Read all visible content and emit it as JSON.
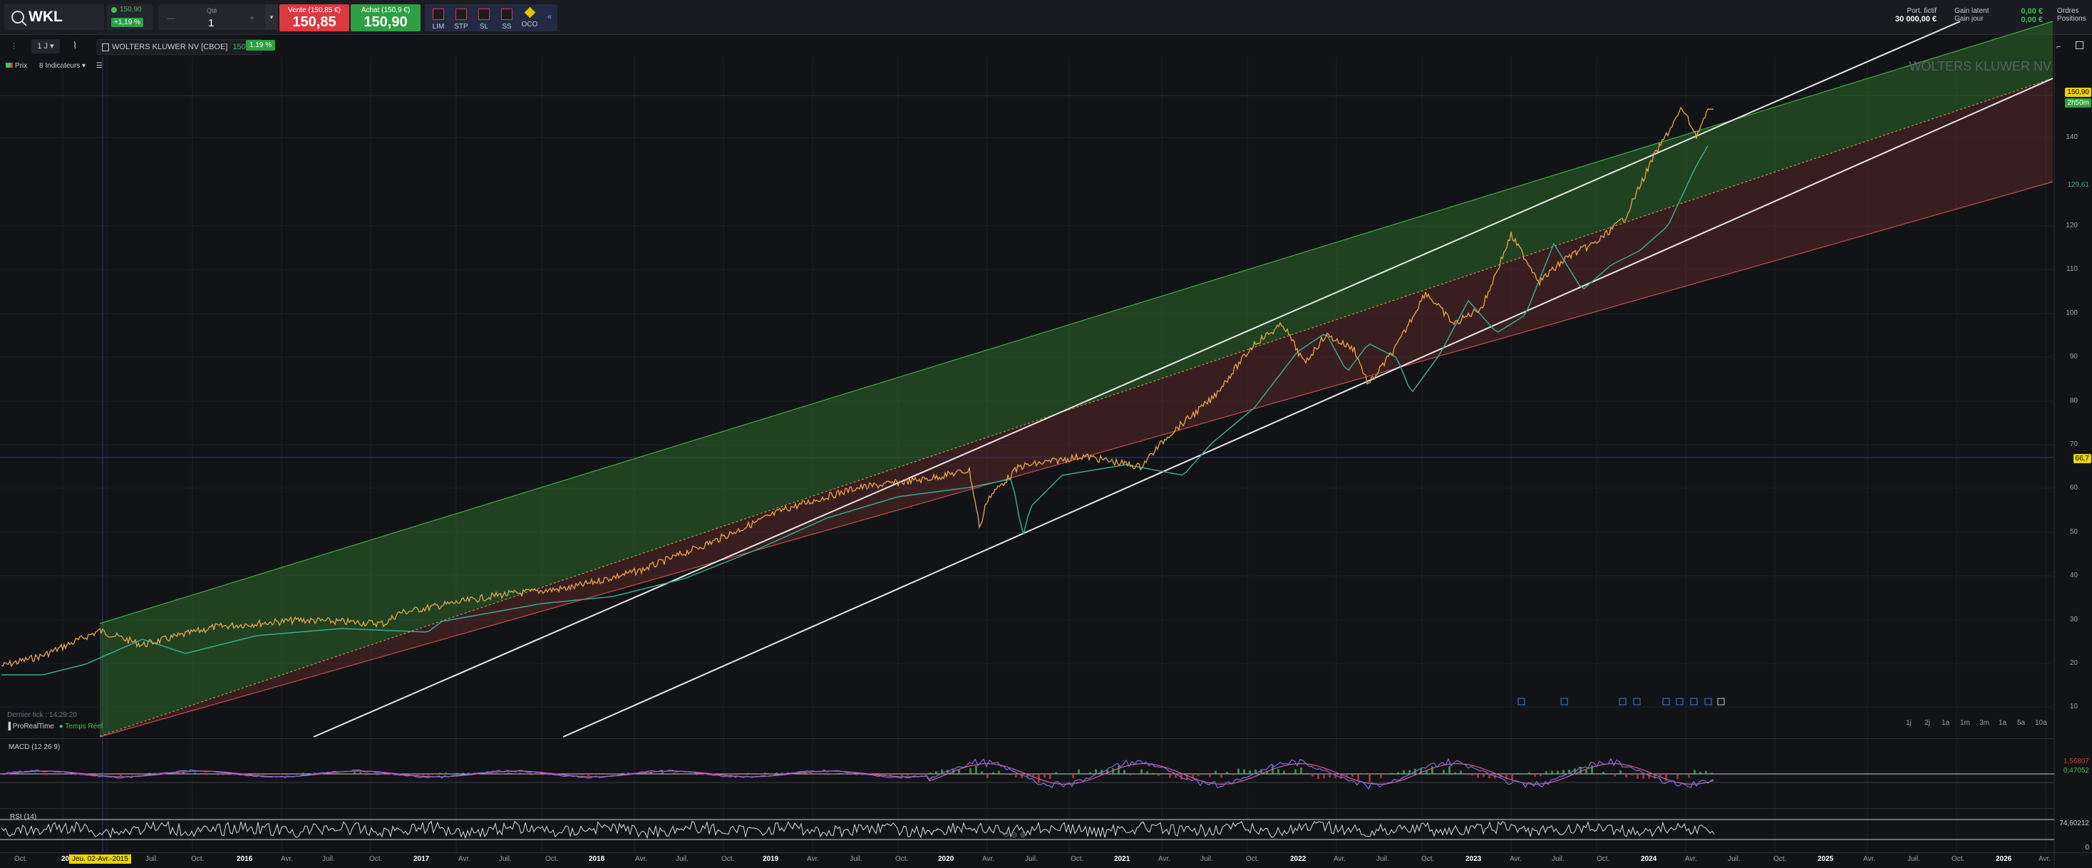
{
  "header": {
    "ticker": "WKL",
    "live_price": "150,90",
    "change_pct": "+1,19 %",
    "qty_label": "Qté",
    "qty_value": "1",
    "sell_label": "Vente (150,85 €)",
    "sell_price": "150,85",
    "buy_label": "Achat (150,9 €)",
    "buy_price": "150,90",
    "order_types": [
      "LIM",
      "STP",
      "SL",
      "SS",
      "OCO"
    ],
    "portfolio_label": "Port. fictif",
    "portfolio_value": "30 000,00 €",
    "gain_latent_label": "Gain latent",
    "gain_latent_value": "0,00 €",
    "gain_jour_label": "Gain jour",
    "gain_jour_value": "0,00 €",
    "orders_label": "Ordres",
    "positions_label": "Positions"
  },
  "toolbar": {
    "period": "1 J",
    "instrument": "WOLTERS KLUWER NV [CBOE]",
    "instrument_price": "150,90",
    "instrument_pct": "1.19 %",
    "price_label": "Prix",
    "indicators": "8 Indicateurs"
  },
  "chart": {
    "watermark": "WOLTERS KLUWER NV",
    "y_ticks": [
      "140",
      "120",
      "110",
      "100",
      "90",
      "80",
      "70",
      "60",
      "50",
      "40",
      "30",
      "20",
      "10"
    ],
    "tags": {
      "last": "150,90",
      "countdown": "2h50m",
      "ma": "129,61",
      "cursor": "66,7"
    },
    "last_tick": "Dernier tick : 14:29:20",
    "prorealtime": "ProRealTime",
    "realtime": "Temps Réel",
    "zoom_options": [
      "1j",
      "2j",
      "1a",
      "1m",
      "3m",
      "1a",
      "5a",
      "10a"
    ],
    "macd_label": "MACD (12 26 9)",
    "macd_value1": "1,56807",
    "macd_value2": "0,47052",
    "rsi_label": "RSI (14)",
    "rsi_value": "74,60212",
    "rsi_zero": "0",
    "cursor_date": "Jeu. 02-Avr.-2015",
    "x_labels": [
      "Oct.",
      "2015",
      "Juil.",
      "Oct.",
      "2016",
      "Avr.",
      "Juil.",
      "Oct.",
      "2017",
      "Avr.",
      "Juil.",
      "Oct.",
      "2018",
      "Avr.",
      "Juil.",
      "Oct.",
      "2019",
      "Avr.",
      "Juil.",
      "Oct.",
      "2020",
      "Avr.",
      "Juil.",
      "Oct.",
      "2021",
      "Avr.",
      "Juil.",
      "Oct.",
      "2022",
      "Avr.",
      "Juil.",
      "Oct.",
      "2023",
      "Avr.",
      "Juil.",
      "Oct.",
      "2024",
      "Avr.",
      "Juil.",
      "Oct.",
      "2025",
      "Avr.",
      "Juil.",
      "Oct.",
      "2026",
      "Avr."
    ]
  },
  "colors": {
    "up": "#3fbf55",
    "down": "#d83a3f",
    "price_line": "#e8a64a",
    "ma_line": "#3aa88f",
    "channel_green": "#2c6a2c",
    "channel_red": "#6a2c2c"
  }
}
